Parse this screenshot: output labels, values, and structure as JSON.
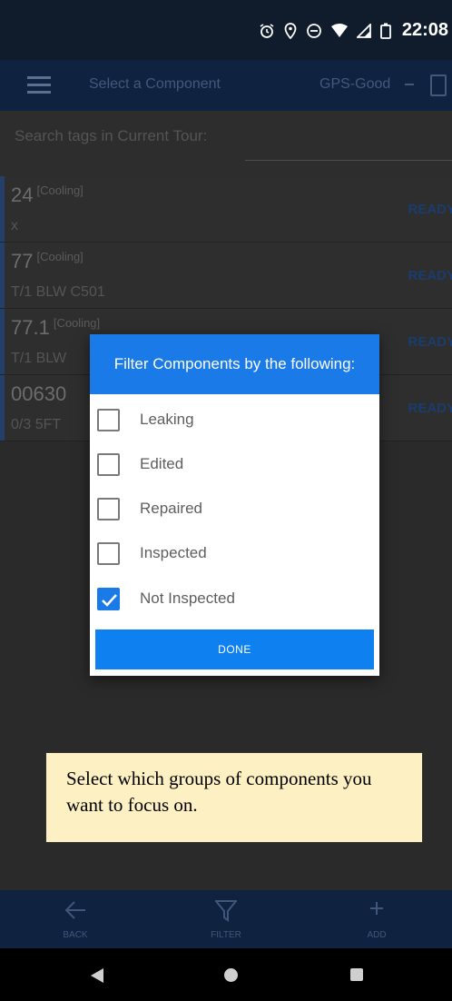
{
  "status_bar": {
    "time": "22:08"
  },
  "app_bar": {
    "title": "Select a Component",
    "gps_status": "GPS-Good"
  },
  "search": {
    "label": "Search tags in Current Tour:"
  },
  "components": [
    {
      "tag": "24",
      "category": "[Cooling]",
      "description": "x",
      "status": "READY"
    },
    {
      "tag": "77",
      "category": "[Cooling]",
      "description": "T/1 BLW C501",
      "status": "READY"
    },
    {
      "tag": "77.1",
      "category": "[Cooling]",
      "description": "T/1 BLW",
      "status": "READY"
    },
    {
      "tag": "00630",
      "category": "",
      "description": "0/3 5FT",
      "status": "READY"
    }
  ],
  "dialog": {
    "title": "Filter Components by the following:",
    "options": [
      {
        "label": "Leaking",
        "checked": false
      },
      {
        "label": "Edited",
        "checked": false
      },
      {
        "label": "Repaired",
        "checked": false
      },
      {
        "label": "Inspected",
        "checked": false
      },
      {
        "label": "Not Inspected",
        "checked": true
      }
    ],
    "done_label": "DONE"
  },
  "callout": {
    "text": "Select which groups of components you want to focus on."
  },
  "toolbar": {
    "back_label": "BACK",
    "filter_label": "FILTER",
    "add_label": "ADD"
  },
  "colors": {
    "accent": "#1a7ae8",
    "appbar": "#0f2240",
    "callout_bg": "#fdf0c2"
  }
}
